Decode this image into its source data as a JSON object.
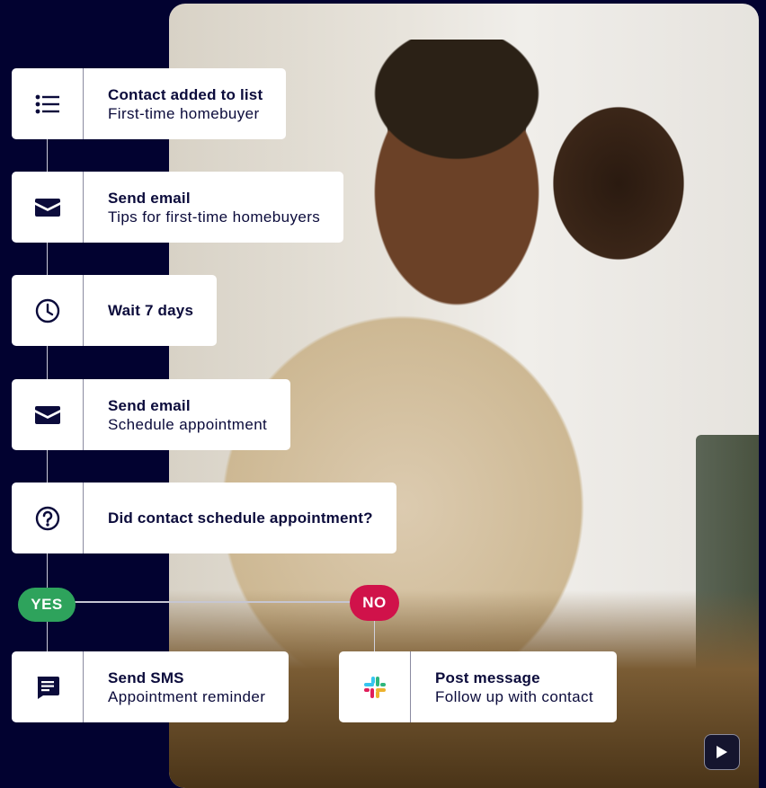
{
  "workflow": {
    "steps": [
      {
        "icon": "list-icon",
        "title": "Contact added to list",
        "subtitle": "First-time homebuyer"
      },
      {
        "icon": "envelope-icon",
        "title": "Send email",
        "subtitle": "Tips for first-time homebuyers"
      },
      {
        "icon": "clock-icon",
        "title": "Wait 7 days",
        "subtitle": ""
      },
      {
        "icon": "envelope-icon",
        "title": "Send email",
        "subtitle": "Schedule appointment"
      },
      {
        "icon": "question-icon",
        "title": "Did contact schedule appointment?",
        "subtitle": ""
      }
    ],
    "branches": {
      "yes": {
        "label": "YES",
        "color": "#2ea35c",
        "action": {
          "icon": "sms-icon",
          "title": "Send SMS",
          "subtitle": "Appointment reminder"
        }
      },
      "no": {
        "label": "NO",
        "color": "#d0124a",
        "action": {
          "icon": "slack-icon",
          "title": "Post message",
          "subtitle": "Follow up with contact"
        }
      }
    }
  },
  "media": {
    "play_icon": "play-icon"
  },
  "colors": {
    "background": "#020230",
    "text": "#0b0b3b"
  }
}
